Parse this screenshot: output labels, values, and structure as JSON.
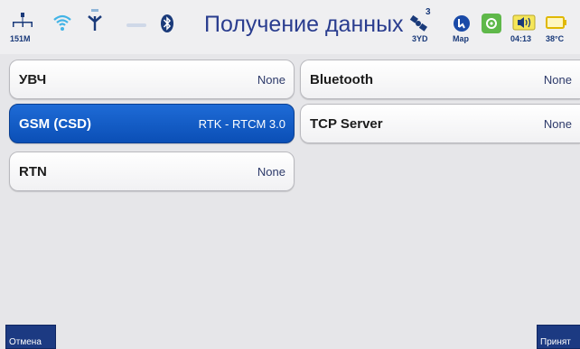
{
  "statusbar": {
    "memory": "151M",
    "satellite_count": "3",
    "fix_status": "3YD",
    "map_label": "Map",
    "time": "04:13",
    "temperature": "38°C"
  },
  "page": {
    "title": "Получение данных"
  },
  "sources": [
    {
      "name": "УВЧ",
      "value": "None",
      "active": false
    },
    {
      "name": "GSM (CSD)",
      "value": "RTK - RTCM 3.0",
      "active": true
    },
    {
      "name": "RTN",
      "value": "None",
      "active": false
    },
    {
      "name": "Bluetooth",
      "value": "None",
      "active": false
    },
    {
      "name": "TCP Server",
      "value": "None",
      "active": false
    }
  ],
  "footer": {
    "cancel_label": "Отмена",
    "accept_label": "Принят"
  },
  "colors": {
    "accent": "#0b4fb6",
    "title": "#2a3d8f",
    "background": "#e6e6e9"
  }
}
